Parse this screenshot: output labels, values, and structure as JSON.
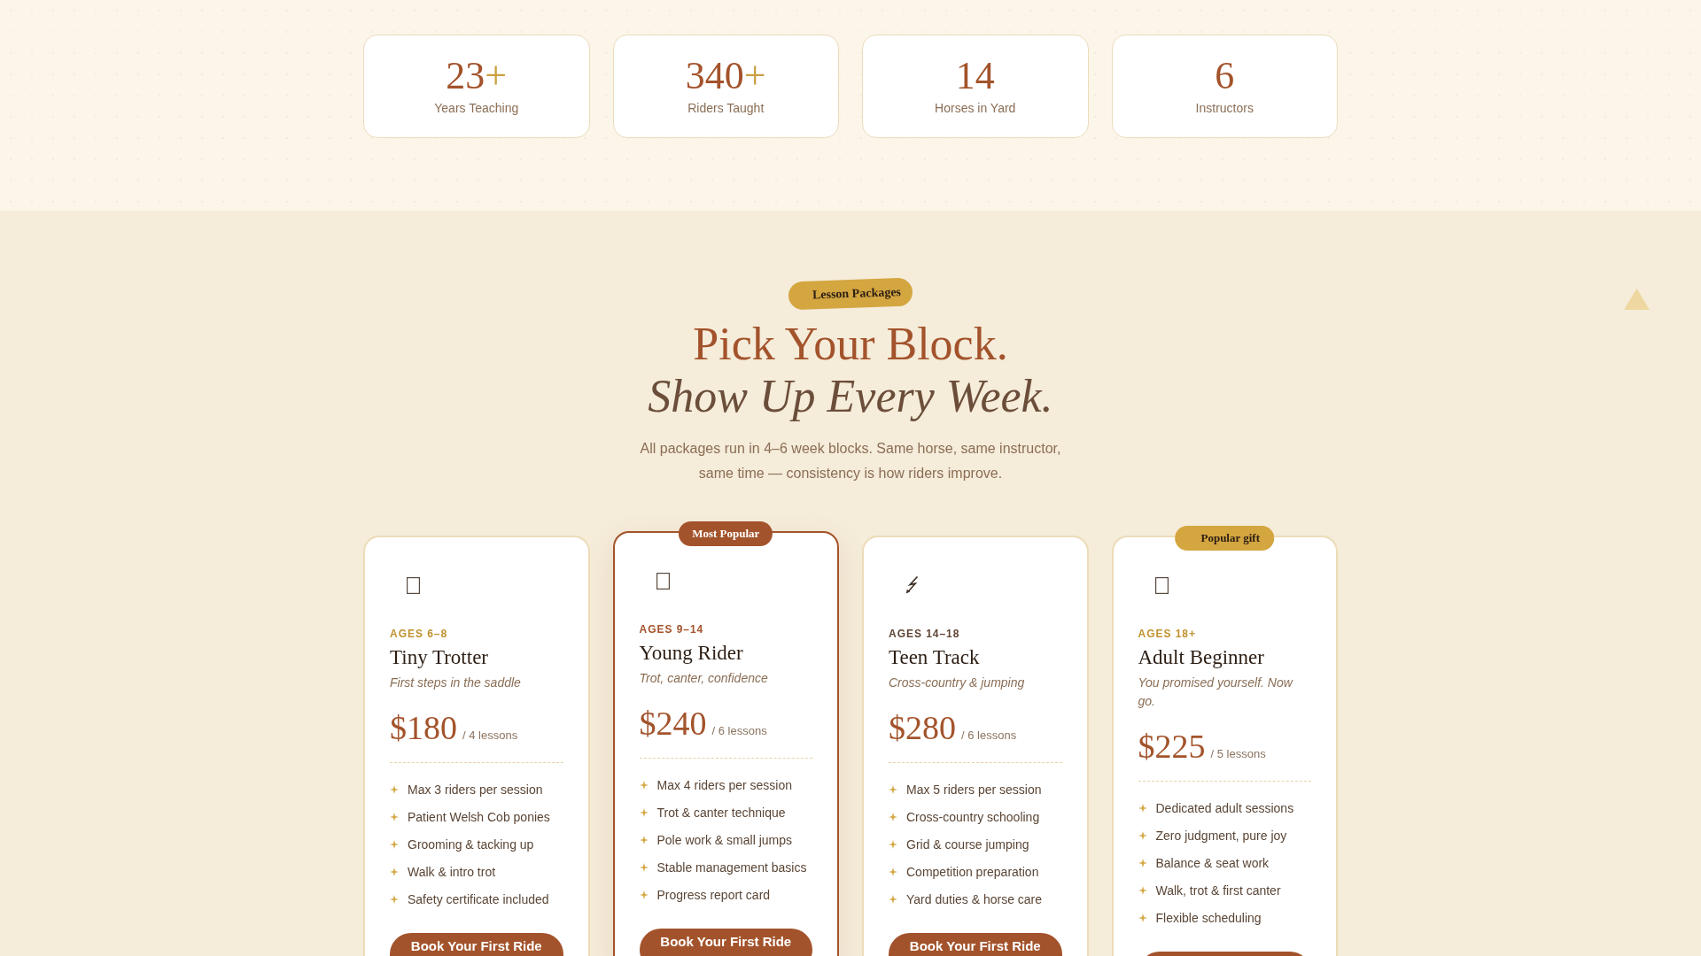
{
  "stats": [
    {
      "value": "23",
      "suffix": "+",
      "label": "Years Teaching"
    },
    {
      "value": "340",
      "suffix": "+",
      "label": "Riders Taught"
    },
    {
      "value": "14",
      "label": "Horses in Yard"
    },
    {
      "value": "6",
      "label": "Instructors"
    }
  ],
  "packages": {
    "tag": "Lesson Packages",
    "title": "Pick Your Block.",
    "title_emphasis": "Show Up Every Week.",
    "intro": "All packages run in 4–6 week blocks. Same horse, same instructor, same time — consistency is how riders improve.",
    "plans": [
      {
        "icon": {
          "kind": "blank"
        },
        "ages": "AGES 6–8",
        "color": "#c0922e",
        "name": "Tiny Trotter",
        "tagline": "First steps in the saddle",
        "price": "$180",
        "period": "/ 4 lessons",
        "features": [
          "Max 3 riders per session",
          "Patient Welsh Cob ponies",
          "Grooming & tacking up",
          "Walk & intro trot",
          "Safety certificate included"
        ],
        "featured": false,
        "button": true,
        "cta": "Book Your First Ride"
      },
      {
        "badge": {
          "kind": "popular",
          "text": "Most Popular"
        },
        "icon": {
          "kind": "blank"
        },
        "ages": "AGES 9–14",
        "color": "#a3532b",
        "name": "Young Rider",
        "tagline": "Trot, canter, confidence",
        "price": "$240",
        "period": "/ 6 lessons",
        "features": [
          "Max 4 riders per session",
          "Trot & canter technique",
          "Pole work & small jumps",
          "Stable management basics",
          "Progress report card"
        ],
        "featured": true,
        "button": true,
        "cta": "Book Your First Ride"
      },
      {
        "icon": {
          "kind": "bolt"
        },
        "ages": "AGES 14–18",
        "color": "#5e4535",
        "name": "Teen Track",
        "tagline": "Cross-country & jumping",
        "price": "$280",
        "period": "/ 6 lessons",
        "features": [
          "Max 5 riders per session",
          "Cross-country schooling",
          "Grid & course jumping",
          "Competition preparation",
          "Yard duties & horse care"
        ],
        "featured": false,
        "button": true,
        "cta": "Book Your First Ride"
      },
      {
        "badge": {
          "kind": "gift",
          "text": "Popular gift"
        },
        "icon": {
          "kind": "blank"
        },
        "ages": "AGES 18+",
        "color": "#c0922e",
        "name": "Adult Beginner",
        "tagline": "You promised yourself. Now go.",
        "price": "$225",
        "period": "/ 5 lessons",
        "features": [
          "Dedicated adult sessions",
          "Zero judgment, pure joy",
          "Balance & seat work",
          "Walk, trot & first canter",
          "Flexible scheduling"
        ],
        "featured": false,
        "button": true
      }
    ]
  }
}
